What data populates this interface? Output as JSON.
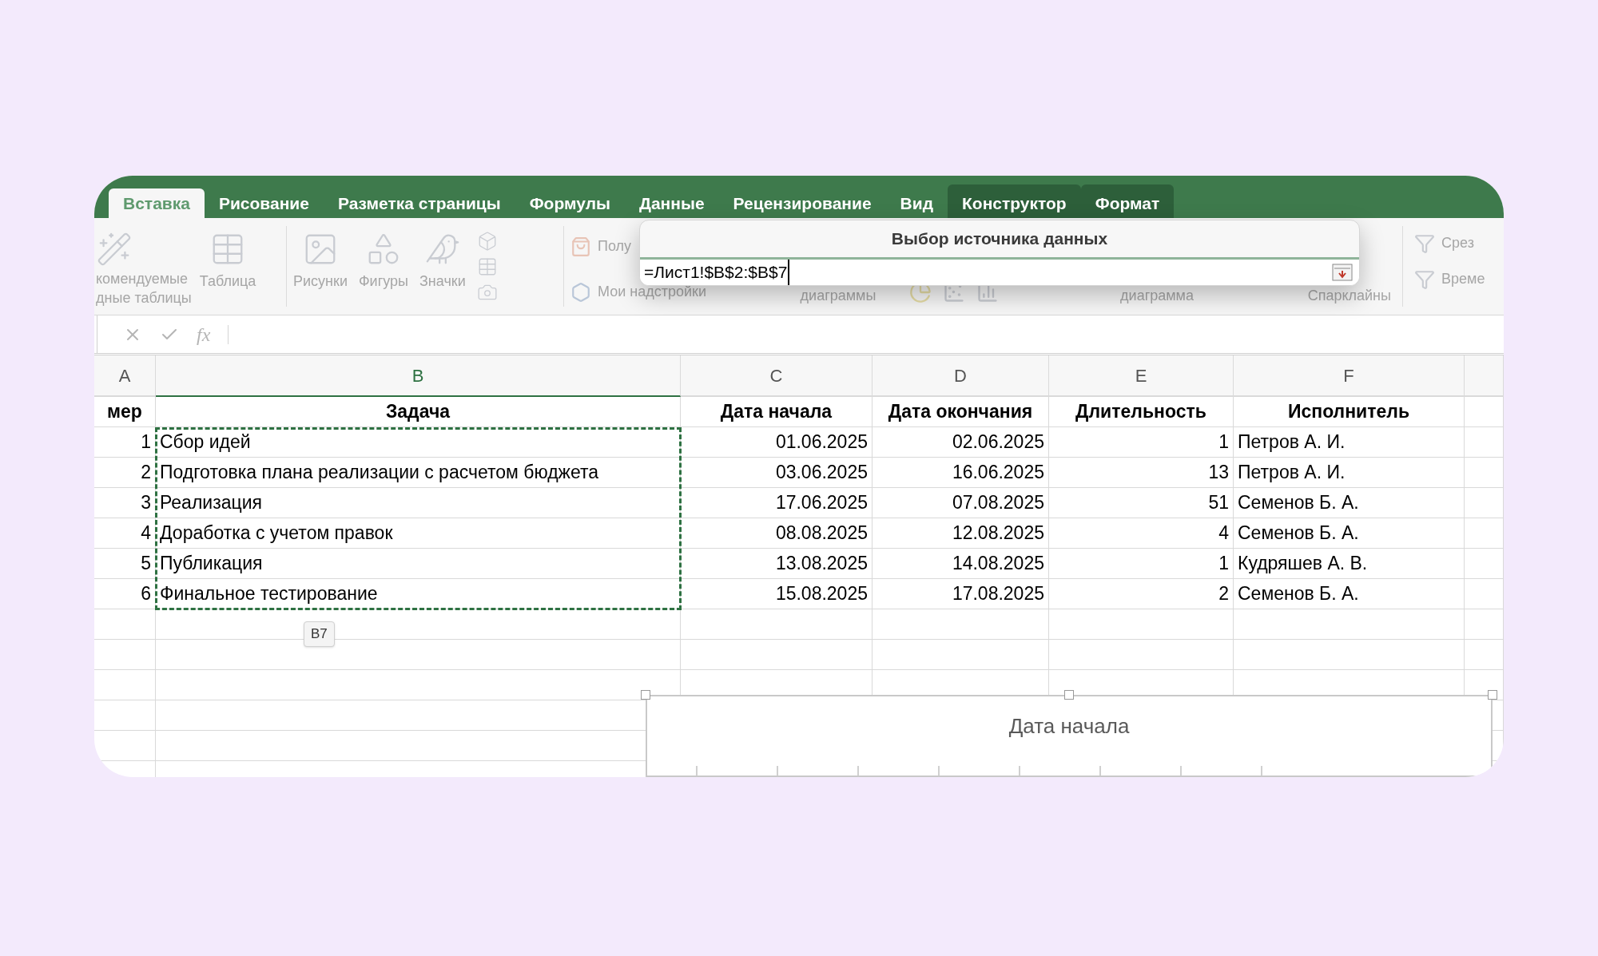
{
  "tabs": [
    {
      "label": "Вставка",
      "selected": true,
      "contextual": false
    },
    {
      "label": "Рисование",
      "selected": false,
      "contextual": false
    },
    {
      "label": "Разметка страницы",
      "selected": false,
      "contextual": false
    },
    {
      "label": "Формулы",
      "selected": false,
      "contextual": false
    },
    {
      "label": "Данные",
      "selected": false,
      "contextual": false
    },
    {
      "label": "Рецензирование",
      "selected": false,
      "contextual": false
    },
    {
      "label": "Вид",
      "selected": false,
      "contextual": false
    },
    {
      "label": "Конструктор",
      "selected": false,
      "contextual": true
    },
    {
      "label": "Формат",
      "selected": false,
      "contextual": true
    }
  ],
  "ribbon": {
    "pivot_lines": [
      "комендуемые",
      "дные таблицы"
    ],
    "table": "Таблица",
    "pictures": "Рисунки",
    "shapes": "Фигуры",
    "icons": "Значки",
    "get_addins": "Полу",
    "my_addins": "Мои надстройки",
    "charts": "диаграммы",
    "pivot_chart": "диаграмма",
    "sparklines": "Спарклайны",
    "slicer": "Срез",
    "timeline": "Време"
  },
  "formula_bar": {
    "fx": "fx"
  },
  "sheet": {
    "columns": [
      {
        "label": "A",
        "selected": false
      },
      {
        "label": "B",
        "selected": true
      },
      {
        "label": "C",
        "selected": false
      },
      {
        "label": "D",
        "selected": false
      },
      {
        "label": "E",
        "selected": false
      },
      {
        "label": "F",
        "selected": false
      }
    ],
    "header_row": [
      "мер",
      "Задача",
      "Дата начала",
      "Дата окончания",
      "Длительность",
      "Исполнитель"
    ],
    "rows": [
      [
        "1",
        "Сбор идей",
        "01.06.2025",
        "02.06.2025",
        "1",
        "Петров А. И."
      ],
      [
        "2",
        "Подготовка плана реализации с расчетом бюджета",
        "03.06.2025",
        "16.06.2025",
        "13",
        "Петров А. И."
      ],
      [
        "3",
        "Реализация",
        "17.06.2025",
        "07.08.2025",
        "51",
        "Семенов Б. А."
      ],
      [
        "4",
        "Доработка с учетом правок",
        "08.08.2025",
        "12.08.2025",
        "4",
        "Семенов Б. А."
      ],
      [
        "5",
        "Публикация",
        "13.08.2025",
        "14.08.2025",
        "1",
        "Кудряшев А. В."
      ],
      [
        "6",
        "Финальное тестирование",
        "15.08.2025",
        "17.08.2025",
        "2",
        "Семенов Б. А."
      ]
    ]
  },
  "range_tooltip": "B7",
  "dialog": {
    "title": "Выбор источника данных",
    "value": "=Лист1!$B$2:$B$7"
  },
  "chart": {
    "title": "Дата начала"
  }
}
